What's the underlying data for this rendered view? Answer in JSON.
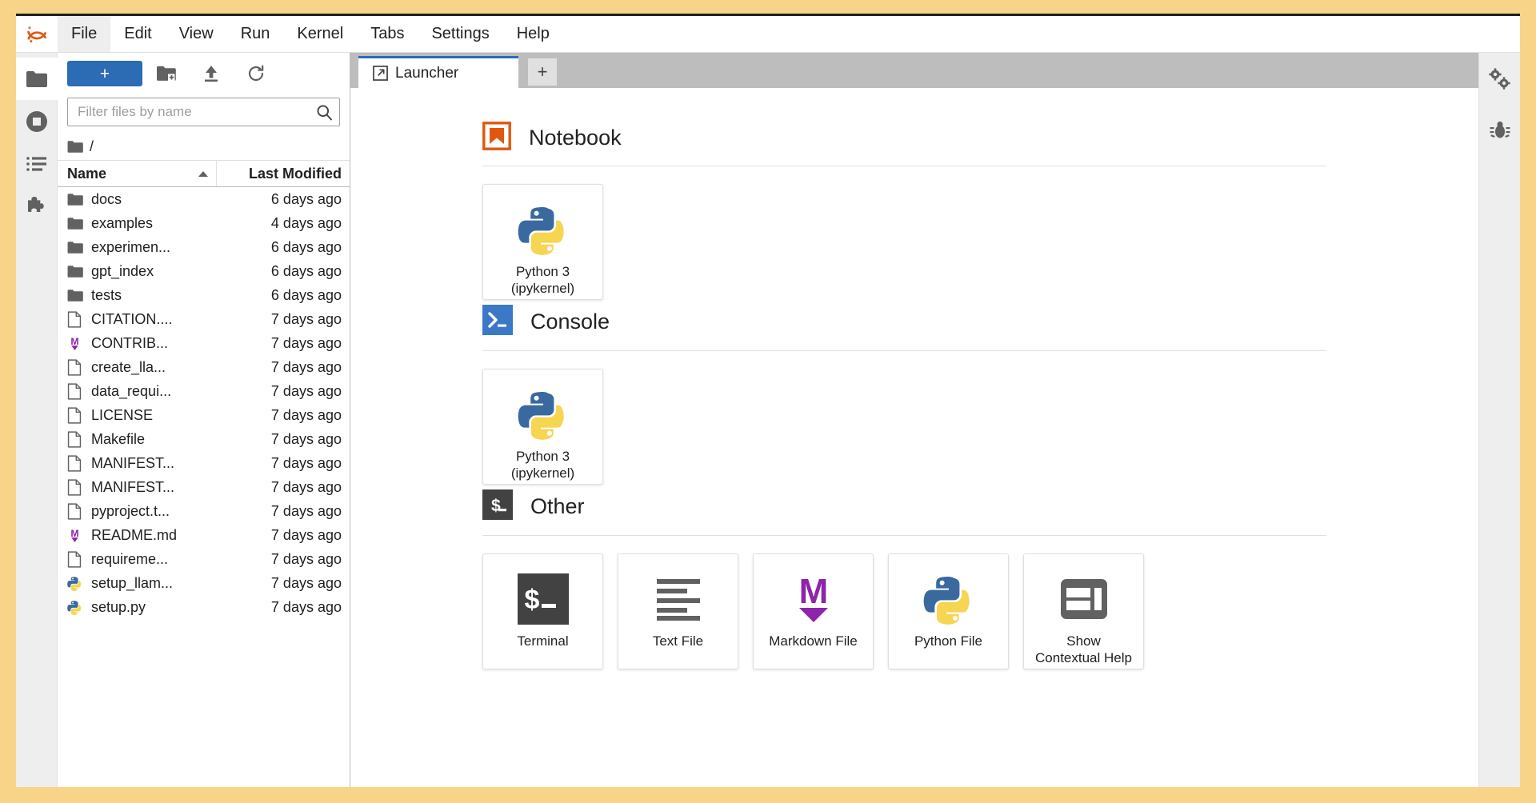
{
  "app": {
    "logo": "jupyter-logo"
  },
  "menubar": {
    "items": [
      {
        "label": "File",
        "active": true
      },
      {
        "label": "Edit",
        "active": false
      },
      {
        "label": "View",
        "active": false
      },
      {
        "label": "Run",
        "active": false
      },
      {
        "label": "Kernel",
        "active": false
      },
      {
        "label": "Tabs",
        "active": false
      },
      {
        "label": "Settings",
        "active": false
      },
      {
        "label": "Help",
        "active": false
      }
    ]
  },
  "activitybar": {
    "items": [
      {
        "name": "file-browser-icon",
        "active": true
      },
      {
        "name": "running-terminals-kernels-icon",
        "active": false
      },
      {
        "name": "commands-icon",
        "active": false
      },
      {
        "name": "extension-manager-icon",
        "active": false
      }
    ]
  },
  "rightbar": {
    "items": [
      {
        "name": "property-inspector-gear-icon"
      },
      {
        "name": "debugger-bug-icon"
      }
    ]
  },
  "filebrowser": {
    "new_launcher_label": "+",
    "toolbar_icons": [
      "new-folder-icon",
      "upload-icon",
      "refresh-icon"
    ],
    "filter": {
      "placeholder": "Filter files by name",
      "value": ""
    },
    "breadcrumb": "/",
    "columns": {
      "name": "Name",
      "last_modified": "Last Modified"
    },
    "sort": "ascending",
    "rows": [
      {
        "icon": "folder",
        "name": "docs",
        "modified": "6 days ago"
      },
      {
        "icon": "folder",
        "name": "examples",
        "modified": "4 days ago"
      },
      {
        "icon": "folder",
        "name": "experimen...",
        "modified": "6 days ago"
      },
      {
        "icon": "folder",
        "name": "gpt_index",
        "modified": "6 days ago"
      },
      {
        "icon": "folder",
        "name": "tests",
        "modified": "6 days ago"
      },
      {
        "icon": "file",
        "name": "CITATION....",
        "modified": "7 days ago"
      },
      {
        "icon": "markdown",
        "name": "CONTRIB...",
        "modified": "7 days ago"
      },
      {
        "icon": "file",
        "name": "create_lla...",
        "modified": "7 days ago"
      },
      {
        "icon": "file",
        "name": "data_requi...",
        "modified": "7 days ago"
      },
      {
        "icon": "file",
        "name": "LICENSE",
        "modified": "7 days ago"
      },
      {
        "icon": "file",
        "name": "Makefile",
        "modified": "7 days ago"
      },
      {
        "icon": "file",
        "name": "MANIFEST...",
        "modified": "7 days ago"
      },
      {
        "icon": "file",
        "name": "MANIFEST...",
        "modified": "7 days ago"
      },
      {
        "icon": "file",
        "name": "pyproject.t...",
        "modified": "7 days ago"
      },
      {
        "icon": "markdown",
        "name": "README.md",
        "modified": "7 days ago"
      },
      {
        "icon": "file",
        "name": "requireme...",
        "modified": "7 days ago"
      },
      {
        "icon": "python",
        "name": "setup_llam...",
        "modified": "7 days ago"
      },
      {
        "icon": "python",
        "name": "setup.py",
        "modified": "7 days ago"
      }
    ]
  },
  "dock": {
    "tabs": [
      {
        "label": "Launcher",
        "icon": "launcher-icon",
        "active": true
      }
    ],
    "add_tab_label": "+"
  },
  "launcher": {
    "sections": [
      {
        "title": "Notebook",
        "icon": "notebook-icon",
        "cards": [
          {
            "label": "Python 3\n(ipykernel)",
            "icon": "python-logo"
          }
        ]
      },
      {
        "title": "Console",
        "icon": "console-icon",
        "cards": [
          {
            "label": "Python 3\n(ipykernel)",
            "icon": "python-logo"
          }
        ]
      },
      {
        "title": "Other",
        "icon": "other-icon",
        "cards": [
          {
            "label": "Terminal",
            "icon": "terminal-icon"
          },
          {
            "label": "Text File",
            "icon": "text-file-icon"
          },
          {
            "label": "Markdown File",
            "icon": "markdown-icon"
          },
          {
            "label": "Python File",
            "icon": "python-logo"
          },
          {
            "label": "Show\nContextual Help",
            "icon": "contextual-help-icon"
          }
        ]
      }
    ]
  },
  "colors": {
    "accent_blue": "#2b6cb5",
    "notebook_orange": "#e2570f",
    "markdown_purple": "#8e24aa",
    "terminal_dark": "#424242",
    "page_border": "#f7d488"
  }
}
